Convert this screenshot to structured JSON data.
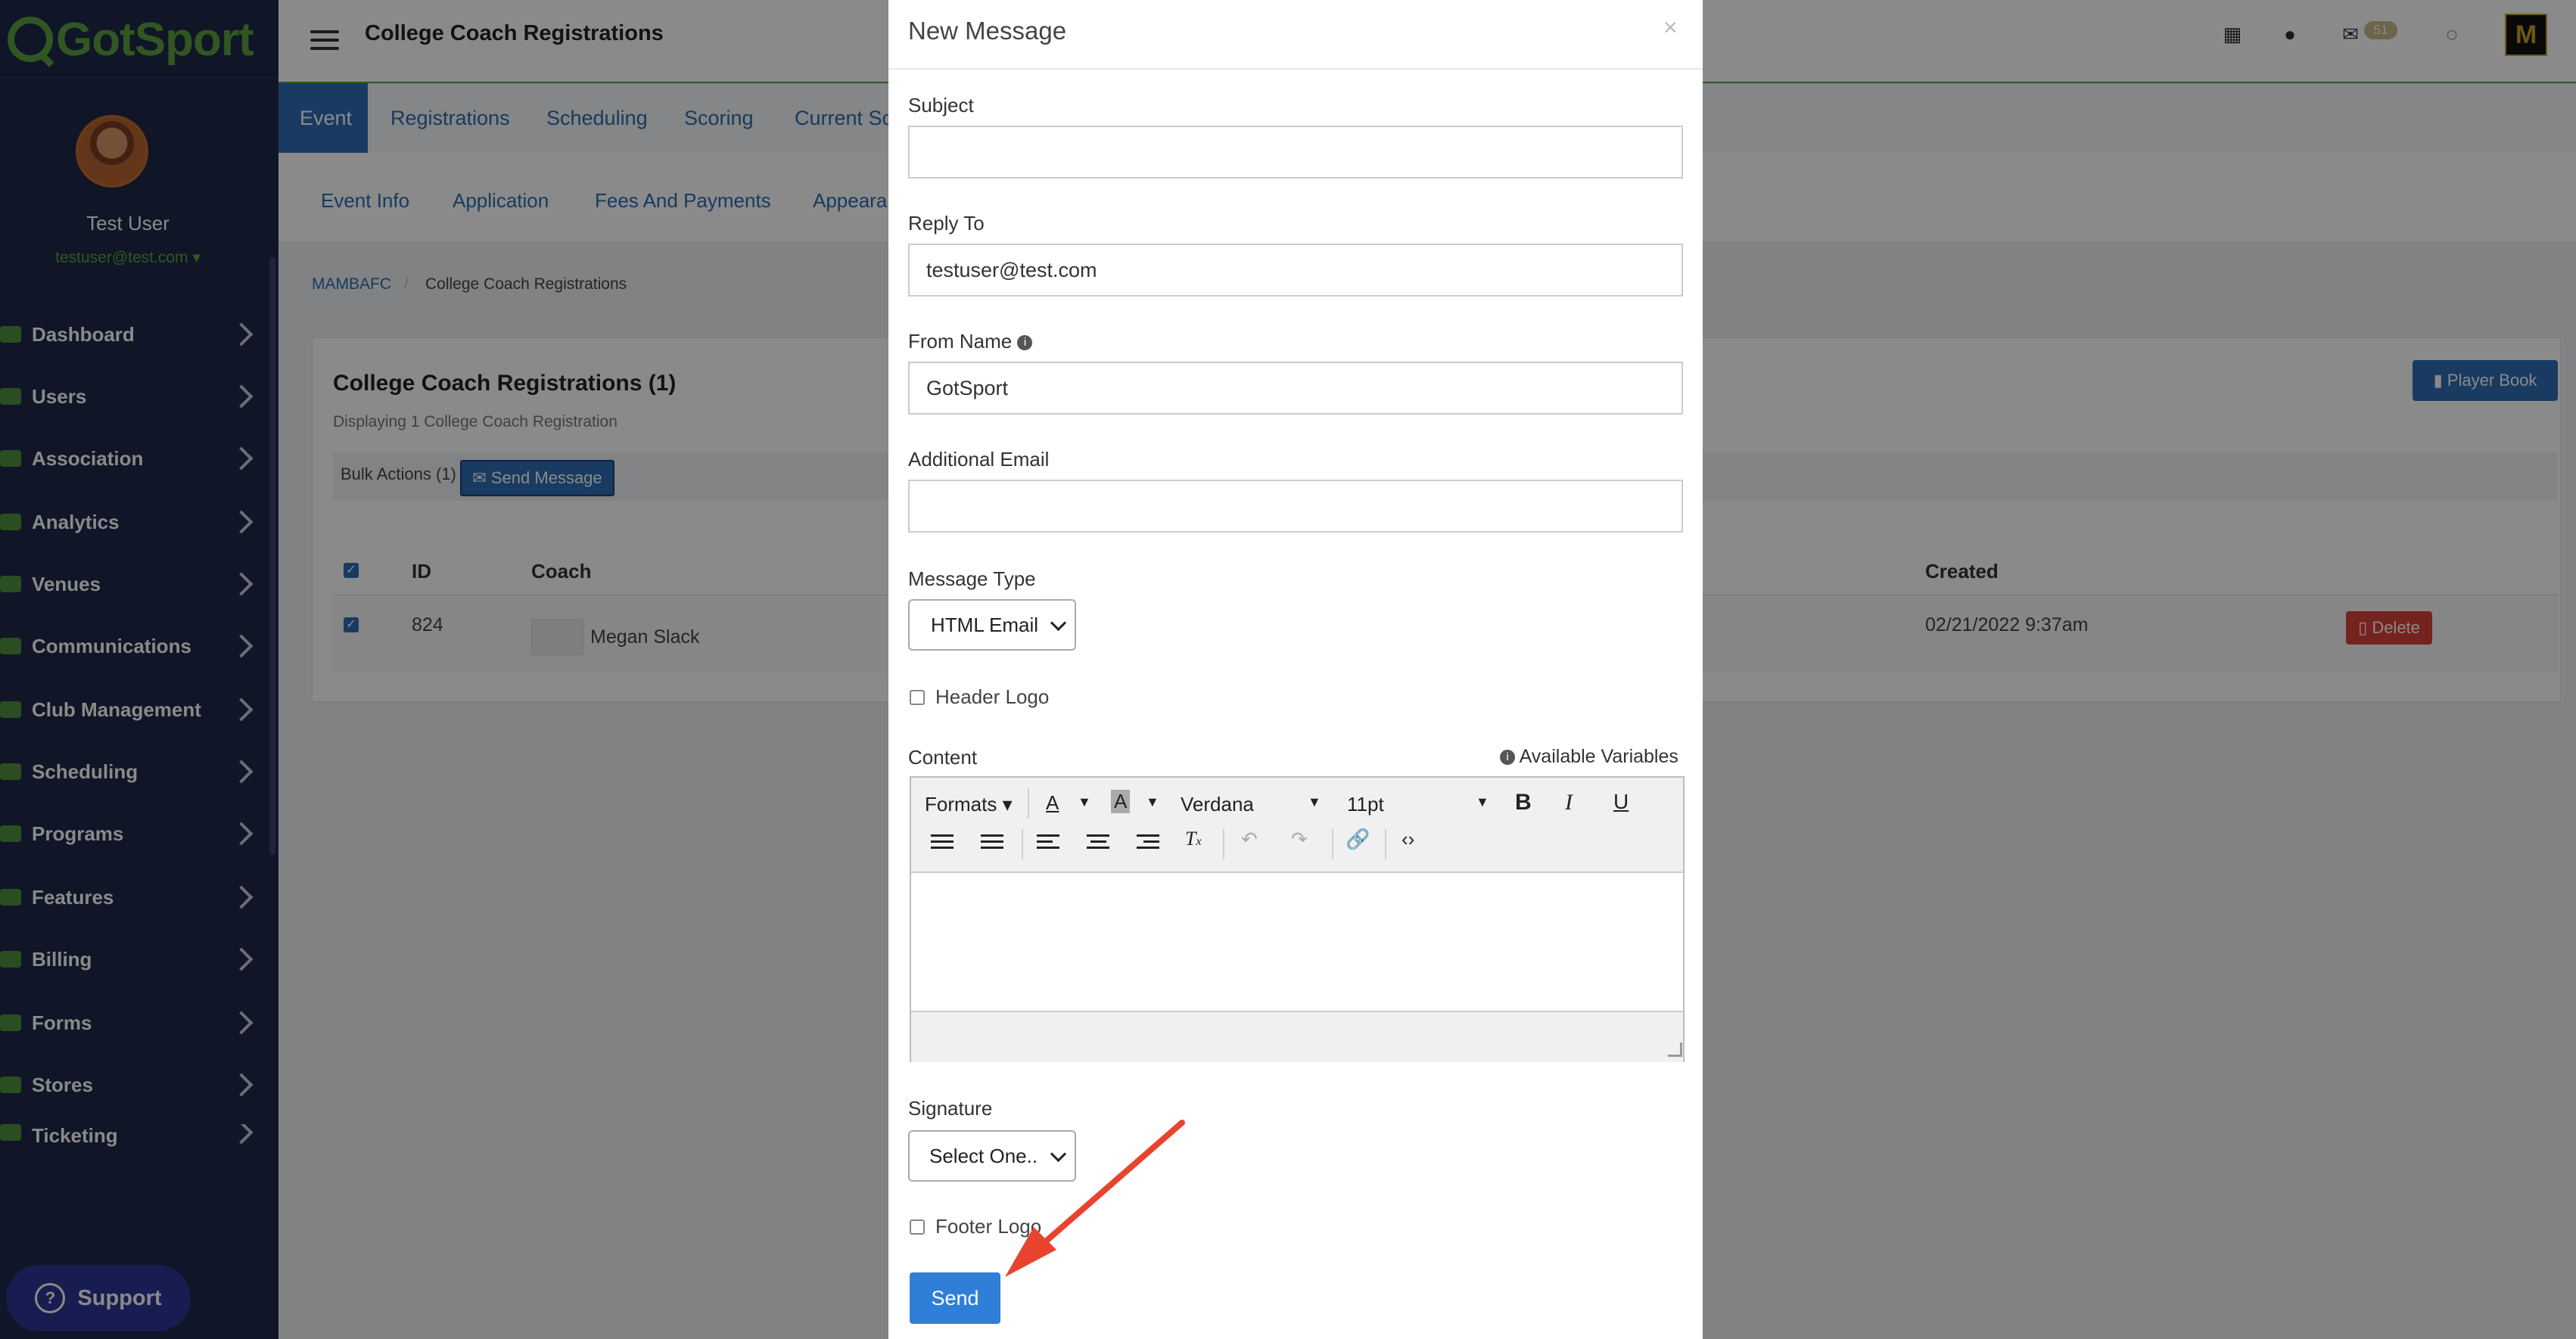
{
  "brand": {
    "name": "GotSport",
    "color": "#5aa23e"
  },
  "user": {
    "name": "Test User",
    "email": "testuser@test.com"
  },
  "sidebar": {
    "items": [
      {
        "label": "Dashboard",
        "icon": "dashboard-icon"
      },
      {
        "label": "Users",
        "icon": "users-icon"
      },
      {
        "label": "Association",
        "icon": "association-icon"
      },
      {
        "label": "Analytics",
        "icon": "analytics-icon"
      },
      {
        "label": "Venues",
        "icon": "venues-icon"
      },
      {
        "label": "Communications",
        "icon": "communications-icon"
      },
      {
        "label": "Club Management",
        "icon": "club-management-icon"
      },
      {
        "label": "Scheduling",
        "icon": "scheduling-icon"
      },
      {
        "label": "Programs",
        "icon": "programs-icon"
      },
      {
        "label": "Features",
        "icon": "star-icon"
      },
      {
        "label": "Billing",
        "icon": "billing-icon"
      },
      {
        "label": "Forms",
        "icon": "forms-icon"
      },
      {
        "label": "Stores",
        "icon": "stores-icon"
      },
      {
        "label": "Ticketing",
        "icon": "ticketing-icon"
      }
    ],
    "support_label": "Support"
  },
  "header": {
    "title": "College Coach Registrations",
    "mail_badge": "51"
  },
  "tabs_primary": [
    "Event",
    "Registrations",
    "Scheduling",
    "Scoring",
    "Current Sc"
  ],
  "tabs_secondary": [
    "Event Info",
    "Application",
    "Fees And Payments",
    "Appeara"
  ],
  "breadcrumb": {
    "root": "MAMBAFC",
    "current": "College Coach Registrations"
  },
  "panel": {
    "title": "College Coach Registrations (1)",
    "subtitle": "Displaying 1 College Coach Registration",
    "bulk_label": "Bulk Actions (1)",
    "send_message_label": "Send Message",
    "player_book_label": "Player Book"
  },
  "table": {
    "columns": {
      "id": "ID",
      "coach": "Coach",
      "created": "Created"
    },
    "rows": [
      {
        "id": "824",
        "coach": "Megan Slack",
        "created": "02/21/2022 9:37am",
        "delete_label": "Delete"
      }
    ]
  },
  "modal": {
    "title": "New Message",
    "close": "×",
    "subject_label": "Subject",
    "subject_value": "",
    "reply_to_label": "Reply To",
    "reply_to_value": "testuser@test.com",
    "from_name_label": "From Name",
    "from_name_value": "GotSport",
    "additional_email_label": "Additional Email",
    "additional_email_value": "",
    "message_type_label": "Message Type",
    "message_type_value": "HTML Email",
    "header_logo_label": "Header Logo",
    "content_label": "Content",
    "available_variables_label": "Available Variables",
    "editor": {
      "formats": "Formats",
      "font": "Verdana",
      "size": "11pt"
    },
    "signature_label": "Signature",
    "signature_value": "Select One..",
    "footer_logo_label": "Footer Logo",
    "send_label": "Send"
  },
  "colors": {
    "sidebar_bg": "#1e2748",
    "primary_blue": "#2f6eb5",
    "danger": "#d9413a",
    "annotation_arrow": "#e8432f"
  }
}
